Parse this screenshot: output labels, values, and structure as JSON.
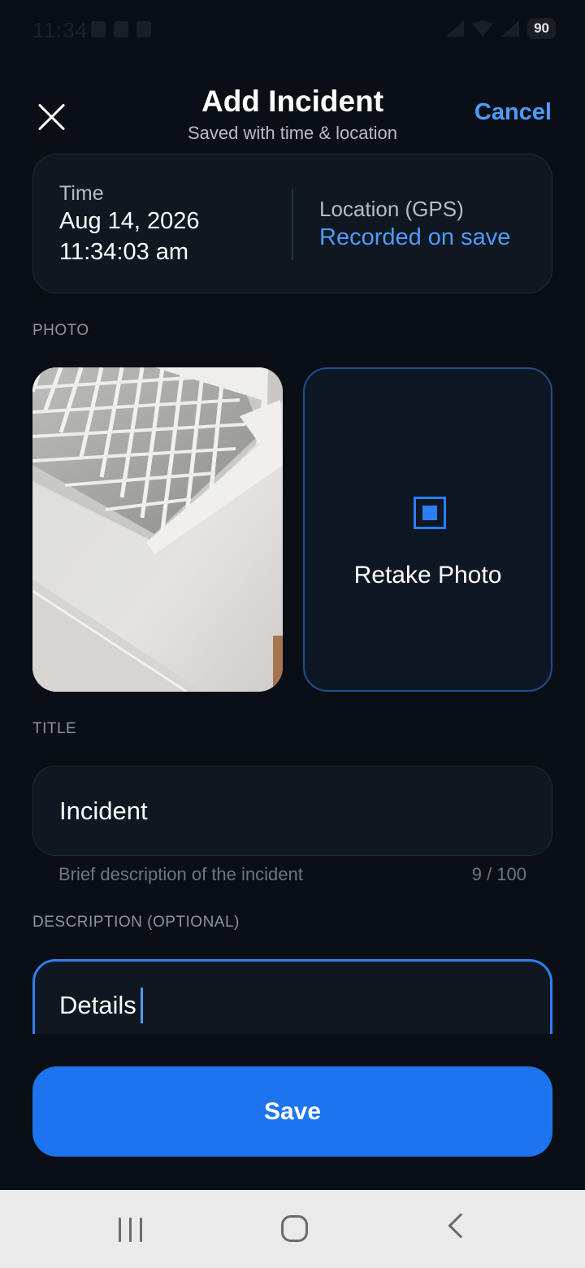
{
  "status_bar": {
    "time": "11:34",
    "battery": "90"
  },
  "header": {
    "title": "Add Incident",
    "subtitle": "Saved with time & location",
    "cancel_label": "Cancel"
  },
  "info_card": {
    "time_label": "Time",
    "time_date": "Aug 14, 2026",
    "time_clock": "11:34:03 am",
    "location_label": "Location (GPS)",
    "location_value": "Recorded on save"
  },
  "photo": {
    "section_label": "PHOTO",
    "retake_label": "Retake Photo"
  },
  "title_field": {
    "section_label": "TITLE",
    "value": "Incident",
    "hint": "Brief description of the incident",
    "counter": "9 / 100"
  },
  "description_field": {
    "section_label": "DESCRIPTION (OPTIONAL)",
    "value": "Details"
  },
  "save_label": "Save",
  "colors": {
    "accent": "#1d74ee",
    "link": "#4d9bff",
    "background": "#0a0f16",
    "card": "#0f1720"
  }
}
